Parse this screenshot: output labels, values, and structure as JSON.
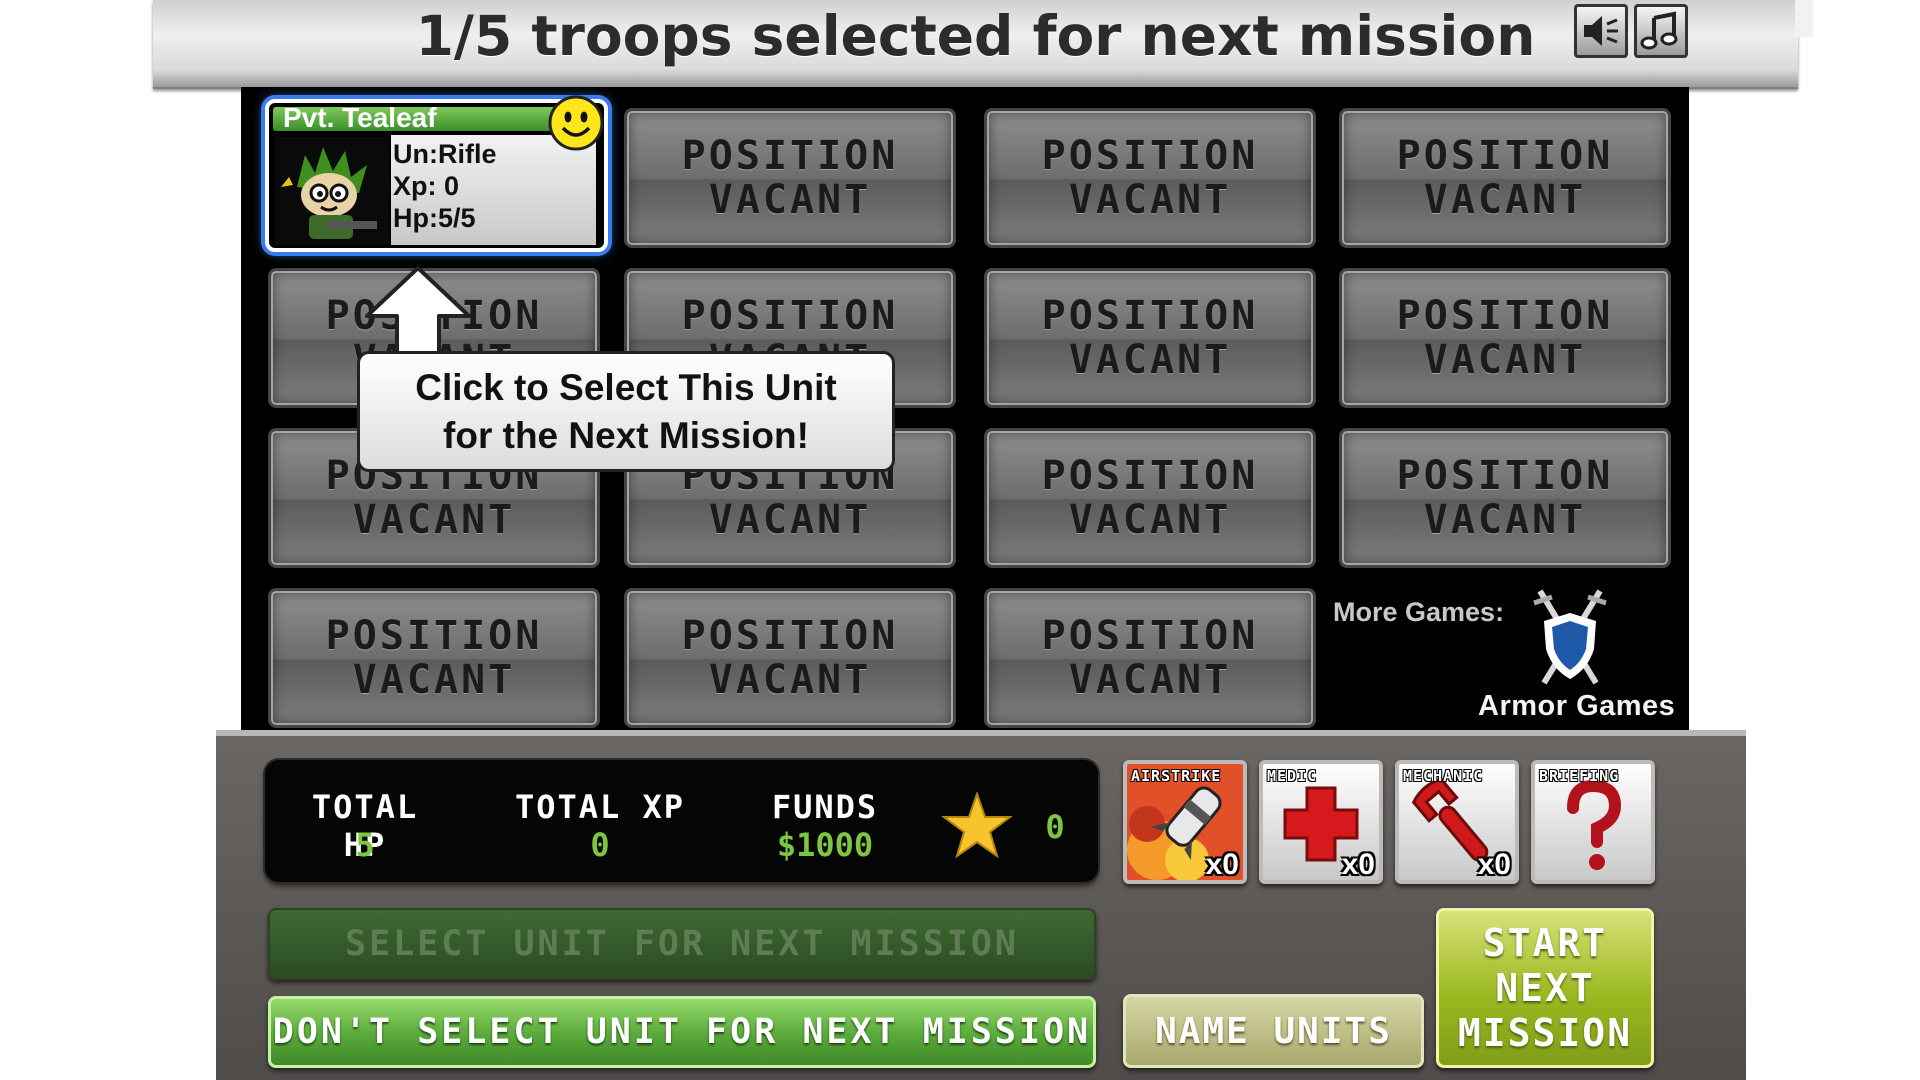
{
  "title": "1/5 troops selected for next mission",
  "sound_buttons": [
    {
      "icon": "speaker-icon"
    },
    {
      "icon": "music-note-icon"
    }
  ],
  "selected_unit": {
    "name": "Pvt. Tealeaf",
    "unit_label": "Un:",
    "unit_value": "Rifle",
    "xp_label": "Xp:",
    "xp_value": "0",
    "hp_label": "Hp:",
    "hp_value": "5/5",
    "mood_icon": "smiley-icon"
  },
  "vacant_slot": {
    "line1": "POSITION",
    "line2": "VACANT"
  },
  "tooltip": {
    "line1": "Click to Select This Unit",
    "line2": "for the Next Mission!"
  },
  "more_games": {
    "label": "More Games:",
    "brand": "Armor Games"
  },
  "stats": {
    "total_hp_label": "TOTAL HP",
    "total_hp": "5",
    "total_xp_label": "TOTAL XP",
    "total_xp": "0",
    "funds_label": "FUNDS",
    "funds": "$1000",
    "stars": "0"
  },
  "support": [
    {
      "label": "AIRSTRIKE",
      "count": "x0",
      "icon": "airstrike-missile-icon"
    },
    {
      "label": "MEDIC",
      "count": "x0",
      "icon": "medic-cross-icon"
    },
    {
      "label": "MECHANIC",
      "count": "x0",
      "icon": "wrench-icon"
    },
    {
      "label": "BRIEFING",
      "count": "",
      "icon": "question-mark-icon"
    }
  ],
  "buttons": {
    "select_unit": "SELECT UNIT FOR NEXT MISSION",
    "dont_select_unit": "DON'T SELECT UNIT FOR NEXT MISSION",
    "name_units": "NAME UNITS",
    "start_line1": "START",
    "start_line2": "NEXT",
    "start_line3": "MISSION"
  },
  "colors": {
    "stat_value": "#7dc63f",
    "selection_glow": "#3a7bf0",
    "start_button": "#9ab820",
    "dont_select_button": "#58a83a"
  }
}
